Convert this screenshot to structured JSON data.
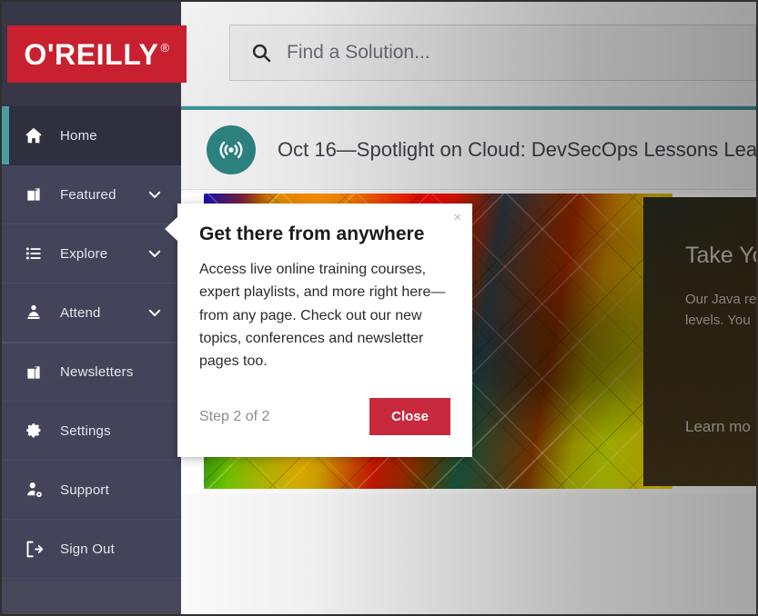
{
  "brand": {
    "name": "O'REILLY",
    "registered_mark": "®",
    "logo_bg": "#c9202f",
    "accent_teal": "#4d9d9b"
  },
  "search": {
    "icon": "search-icon",
    "placeholder": "Find a Solution...",
    "value": ""
  },
  "sidebar": {
    "items": [
      {
        "label": "Home",
        "icon": "home-icon",
        "active": true,
        "expandable": false
      },
      {
        "label": "Featured",
        "icon": "briefcase-icon",
        "active": false,
        "expandable": true
      },
      {
        "label": "Explore",
        "icon": "list-icon",
        "active": false,
        "expandable": true
      },
      {
        "label": "Attend",
        "icon": "person-icon",
        "active": false,
        "expandable": true
      },
      {
        "label": "Newsletters",
        "icon": "briefcase-icon",
        "active": false,
        "expandable": false
      },
      {
        "label": "Settings",
        "icon": "gear-icon",
        "active": false,
        "expandable": false
      },
      {
        "label": "Support",
        "icon": "user-gear-icon",
        "active": false,
        "expandable": false
      },
      {
        "label": "Sign Out",
        "icon": "sign-out-icon",
        "active": false,
        "expandable": false
      }
    ]
  },
  "banner": {
    "icon": "broadcast-icon",
    "text": "Oct 16—Spotlight on Cloud: DevSecOps Lessons Lea"
  },
  "hero": {
    "title": "Take Yo",
    "body_line1": "Our Java re",
    "body_line2": "levels. You",
    "link": "Learn mo"
  },
  "popover": {
    "title": "Get there from anywhere",
    "body": "Access live online training courses, expert playlists, and more right here—from any page. Check out our new topics, conferences and newsletter pages too.",
    "step": "Step 2 of 2",
    "close_button": "Close",
    "close_x": "×"
  }
}
